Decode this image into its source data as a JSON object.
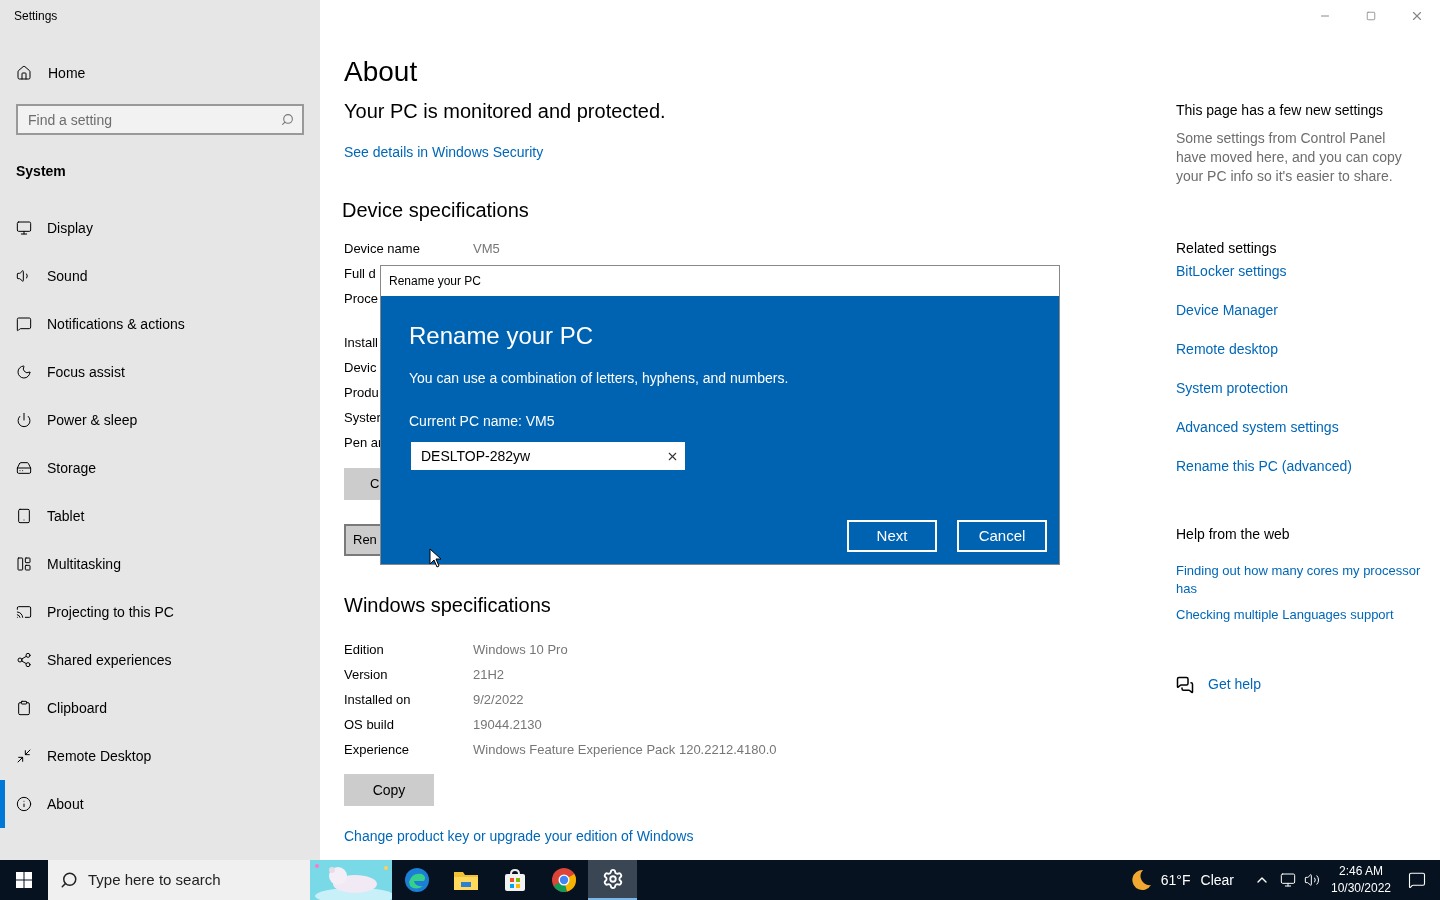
{
  "window": {
    "title": "Settings"
  },
  "sidebar": {
    "home": "Home",
    "search": {
      "placeholder": "Find a setting"
    },
    "section": "System",
    "items": [
      {
        "label": "Display",
        "selected": false
      },
      {
        "label": "Sound",
        "selected": false
      },
      {
        "label": "Notifications & actions",
        "selected": false
      },
      {
        "label": "Focus assist",
        "selected": false
      },
      {
        "label": "Power & sleep",
        "selected": false
      },
      {
        "label": "Storage",
        "selected": false
      },
      {
        "label": "Tablet",
        "selected": false
      },
      {
        "label": "Multitasking",
        "selected": false
      },
      {
        "label": "Projecting to this PC",
        "selected": false
      },
      {
        "label": "Shared experiences",
        "selected": false
      },
      {
        "label": "Clipboard",
        "selected": false
      },
      {
        "label": "Remote Desktop",
        "selected": false
      },
      {
        "label": "About",
        "selected": true
      }
    ]
  },
  "main": {
    "title": "About",
    "security_status": "Your PC is monitored and protected.",
    "security_link": "See details in Windows Security",
    "device_specs": {
      "heading": "Device specifications",
      "rows": [
        {
          "label": "Device name",
          "value": "VM5"
        },
        {
          "label": "Full d"
        },
        {
          "label": "Proce"
        },
        {
          "label": "Install"
        },
        {
          "label": "Devic"
        },
        {
          "label": "Produ"
        },
        {
          "label": "Syster"
        },
        {
          "label": "Pen ar"
        }
      ],
      "buttons": [
        "C",
        "Ren"
      ]
    },
    "windows_specs": {
      "heading": "Windows specifications",
      "rows": [
        {
          "label": "Edition",
          "value": "Windows 10 Pro"
        },
        {
          "label": "Version",
          "value": "21H2"
        },
        {
          "label": "Installed on",
          "value": "9/2/2022"
        },
        {
          "label": "OS build",
          "value": "19044.2130"
        },
        {
          "label": "Experience",
          "value": "Windows Feature Experience Pack 120.2212.4180.0"
        }
      ],
      "copy_button": "Copy"
    },
    "upgrade_link": "Change product key or upgrade your edition of Windows"
  },
  "right_panel": {
    "new_settings": {
      "heading": "This page has a few new settings",
      "text": "Some settings from Control Panel have moved here, and you can copy your PC info so it's easier to share."
    },
    "related": {
      "heading": "Related settings",
      "links": [
        "BitLocker settings",
        "Device Manager",
        "Remote desktop",
        "System protection",
        "Advanced system settings",
        "Rename this PC (advanced)"
      ]
    },
    "help": {
      "heading": "Help from the web",
      "links": [
        "Finding out how many cores my processor has",
        "Checking multiple Languages support"
      ]
    },
    "get_help": "Get help"
  },
  "dialog": {
    "title": "Rename your PC",
    "heading": "Rename your PC",
    "description": "You can use a combination of letters, hyphens, and numbers.",
    "current_name": "Current PC name: VM5",
    "name_field": {
      "value": "DESLTOP-282yw"
    },
    "buttons": [
      "Next",
      "Cancel"
    ]
  },
  "taskbar": {
    "search": {
      "placeholder": "Type here to search"
    },
    "apps": [
      {
        "kind": "edge",
        "selected": false
      },
      {
        "kind": "explorer",
        "selected": false
      },
      {
        "kind": "store",
        "selected": false
      },
      {
        "kind": "chrome",
        "selected": false
      },
      {
        "kind": "settings",
        "selected": true
      }
    ],
    "weather": {
      "temperature": "61°F",
      "condition": "Clear"
    },
    "time": "2:46 AM",
    "date": "10/30/2022"
  }
}
